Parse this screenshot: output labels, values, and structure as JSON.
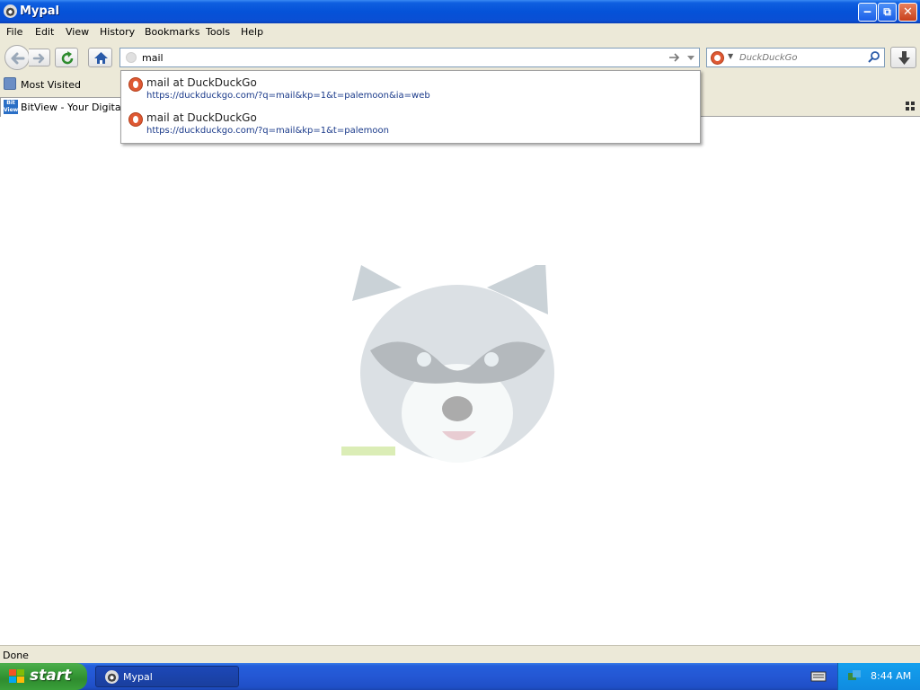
{
  "window": {
    "title": "Mypal",
    "buttons": {
      "minimize": "minimize",
      "maximize": "restore",
      "close": "close"
    }
  },
  "menu": [
    "File",
    "Edit",
    "View",
    "History",
    "Bookmarks",
    "Tools",
    "Help"
  ],
  "navbar": {
    "url_value": "mail",
    "search_engine": "DuckDuckGo",
    "search_placeholder": "DuckDuckGo"
  },
  "bookmarks": {
    "items": [
      {
        "label": "Most Visited",
        "icon": "bookmark-folder-icon"
      }
    ]
  },
  "tabs": [
    {
      "title": "BitView - Your Digital Video Repository",
      "favicon_text": "Bit View"
    }
  ],
  "autocomplete": [
    {
      "title": "mail at DuckDuckGo",
      "url": "https://duckduckgo.com/?q=mail&kp=1&t=palemoon&ia=web"
    },
    {
      "title": "mail at DuckDuckGo",
      "url": "https://duckduckgo.com/?q=mail&kp=1&t=palemoon"
    }
  ],
  "status": {
    "text": "Done"
  },
  "taskbar": {
    "start_label": "start",
    "tasks": [
      {
        "label": "Mypal"
      }
    ],
    "clock": "8:44 AM"
  },
  "colors": {
    "titlebar": "#0552d8",
    "chrome": "#ece9d8",
    "ddg_accent": "#de5833",
    "taskbar": "#245edb",
    "start_green": "#379a37"
  }
}
